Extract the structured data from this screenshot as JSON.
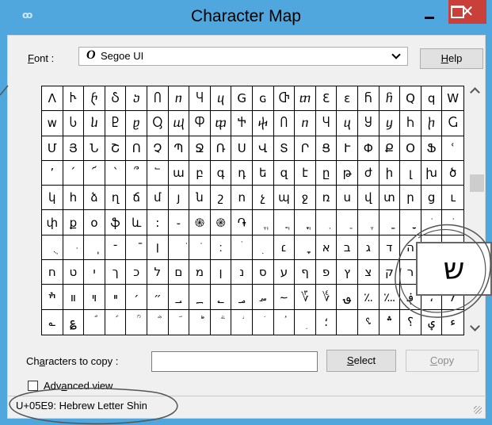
{
  "window": {
    "title": "Character Map",
    "close_glyph": "✕"
  },
  "font_row": {
    "label_first": "F",
    "label_rest": "ont :",
    "font_logo": "O",
    "font_name": "Segoe UI",
    "help_first": "H",
    "help_rest": "elp"
  },
  "grid": {
    "characters": [
      "ⴷ",
      "Ⴡ",
      "ⴡ",
      "Ⴢ",
      "ⴢ",
      "Ⴖ",
      "ⴖ",
      "Ⴗ",
      "ⴗ",
      "G",
      "ɢ",
      "Ⴇ",
      "ⴇ",
      "Ɛ",
      "ɛ",
      "Ⴌ",
      "ⴌ",
      "Q",
      "q",
      "W",
      "w",
      "Ⴑ",
      "ⴑ",
      "Ⴒ",
      "ⴒ",
      "Ⴓ",
      "ⴓ",
      "Ⴔ",
      "ⴔ",
      "Ⴕ",
      "ⴕ",
      "Ⴖ",
      "ⴖ",
      "Ⴗ",
      "ⴗ",
      "Ⴘ",
      "ⴘ",
      "Ⴙ",
      "ⴙ",
      "Ⴚ",
      "Մ",
      "Յ",
      "Ն",
      "Շ",
      "Ո",
      "Չ",
      "Պ",
      "Ջ",
      "Ռ",
      "Ս",
      "Վ",
      "Տ",
      "Ր",
      "Ց",
      "Ւ",
      "Փ",
      "Ք",
      "Օ",
      "Ֆ",
      "ՙ",
      "՚",
      "՛",
      "՜",
      "՝",
      "՞",
      "՟",
      "ա",
      "բ",
      "գ",
      "դ",
      "ե",
      "զ",
      "է",
      "ը",
      "թ",
      "ժ",
      "ի",
      "լ",
      "խ",
      "ծ",
      "կ",
      "հ",
      "ձ",
      "ղ",
      "ճ",
      "մ",
      "յ",
      "ն",
      "շ",
      "ո",
      "չ",
      "պ",
      "ջ",
      "ռ",
      "ս",
      "վ",
      "տ",
      "ր",
      "ց",
      "ւ",
      "փ",
      "ք",
      "օ",
      "ֆ",
      "և",
      ":",
      "֊",
      "֍",
      "֎",
      "֏",
      "ֱ",
      "ֲ",
      "ֳ",
      "ִ",
      "ֵ",
      "ֶ",
      "ַ",
      "ָ",
      "ֹ",
      "ֺ",
      "ֻ",
      "ּ",
      "ֽ",
      "־",
      "ֿ",
      "׀",
      "ׁ",
      "ׂ",
      "׃",
      "ׄ",
      "ׅ",
      "׆",
      "ׇ",
      "א",
      "ב",
      "ג",
      "ד",
      "ה",
      "ו",
      "ז",
      "ח",
      "ט",
      "י",
      "ך",
      "כ",
      "ל",
      "ם",
      "מ",
      "ן",
      "נ",
      "ס",
      "ע",
      "ף",
      "פ",
      "ץ",
      "צ",
      "ק",
      "ר",
      "ש",
      "ת",
      "ׯ",
      "װ",
      "ױ",
      "ײ",
      "׳",
      "״",
      "؀",
      "؁",
      "؂",
      "؃",
      "؄",
      "؅",
      "؆",
      "؇",
      "؈",
      "؉",
      "؊",
      "؋",
      "،",
      "؍",
      "؎",
      "؏",
      "ؐ",
      "ؑ",
      "ؒ",
      "ؓ",
      "ؔ",
      "ؕ",
      "ؖ",
      "ؗ",
      "ؘ",
      "ؙ",
      "ؚ",
      "؛",
      "؜",
      "؝",
      "؞",
      "؟",
      "ؠ",
      "ء"
    ],
    "zoomed_char": "ש"
  },
  "copy_row": {
    "label_a": "Ch",
    "label_u": "a",
    "label_b": "racters to copy :",
    "value": "",
    "select_first": "S",
    "select_rest": "elect",
    "copy_first": "C",
    "copy_rest": "opy"
  },
  "advanced": {
    "label_a": "Adv",
    "label_u": "a",
    "label_b": "nced view",
    "checked": false
  },
  "status": {
    "text": "U+05E9: Hebrew Letter Shin"
  },
  "colors": {
    "titlebar": "#4fa7dd",
    "close_button": "#c9403b",
    "dialog_background": "#f0f0f0",
    "annotation_ink": "#555555"
  }
}
